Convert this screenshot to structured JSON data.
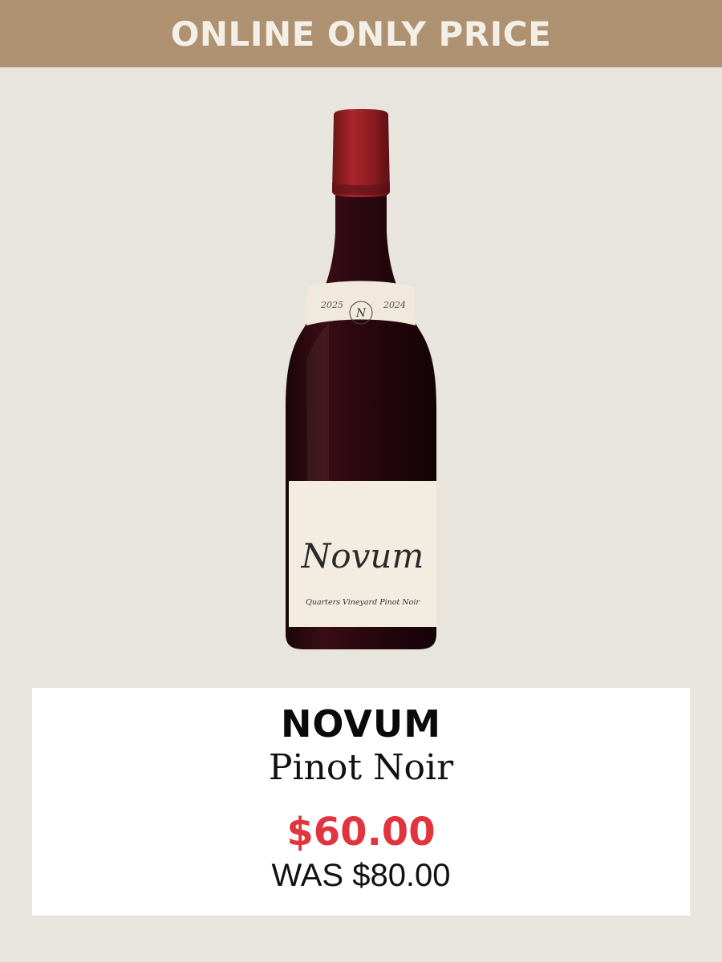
{
  "banner": {
    "text": "ONLINE ONLY PRICE"
  },
  "product": {
    "brand": "NOVUM",
    "varietal": "Pinot Noir",
    "price": "$60.00",
    "was_price": "WAS $80.00",
    "label": {
      "brand_script": "Novum",
      "subtitle": "Quarters Vineyard Pinot Noir",
      "neck_left": "2025",
      "neck_right": "2024",
      "monogram": "N"
    }
  },
  "colors": {
    "banner_bg": "#ad9170",
    "page_bg": "#e8e4de",
    "price": "#e2343e",
    "capsule": "#8e1f24",
    "bottle": "#2a0a10"
  }
}
